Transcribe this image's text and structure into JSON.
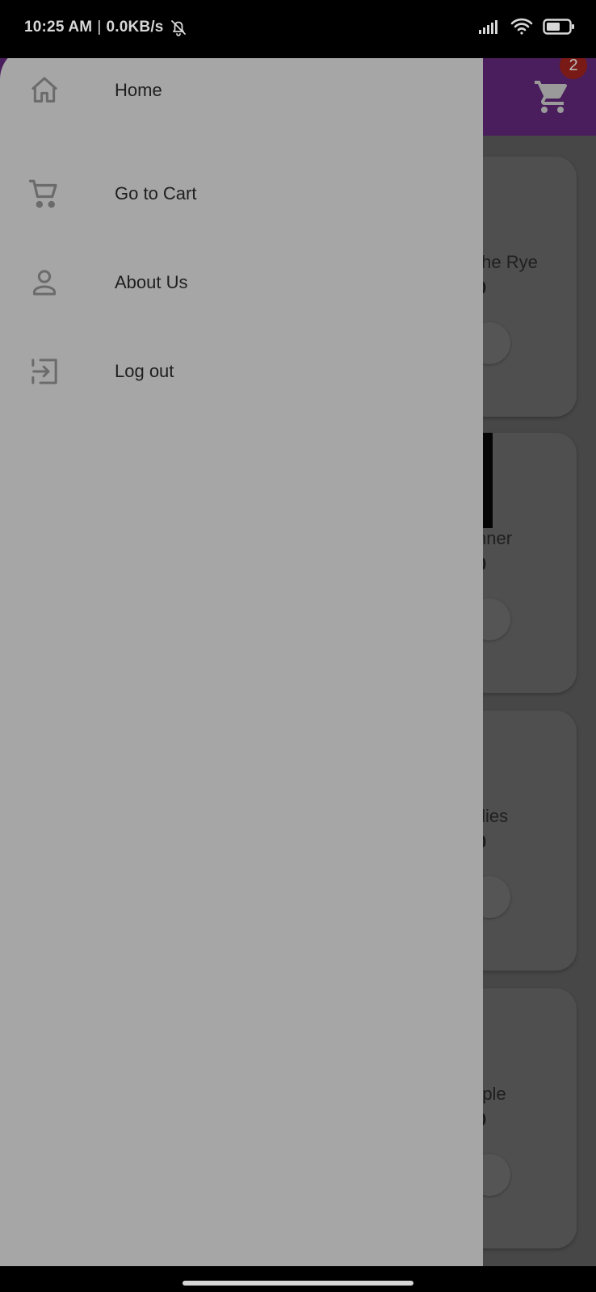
{
  "status_bar": {
    "time": "10:25 AM",
    "separator": "|",
    "network_speed": "0.0KB/s",
    "icons": [
      "bell-off-icon",
      "signal-icon",
      "wifi-icon",
      "battery-icon"
    ]
  },
  "app_bar": {
    "cart_icon": "shopping-cart-icon",
    "cart_badge_count": "2",
    "background_color": "#4a1e5c"
  },
  "products": [
    {
      "title_visible": "the Rye",
      "price_visible": "0"
    },
    {
      "title_visible": "nner",
      "price_visible": "0"
    },
    {
      "title_visible": "flies",
      "price_visible": "0"
    },
    {
      "title_visible": "rple",
      "price_visible": "0"
    }
  ],
  "drawer": {
    "background_color": "#a6a6a6",
    "items": [
      {
        "label": "Home",
        "icon": "home-icon"
      },
      {
        "label": "Go to Cart",
        "icon": "shopping-cart-icon"
      },
      {
        "label": "About Us",
        "icon": "person-icon"
      },
      {
        "label": "Log out",
        "icon": "logout-icon"
      }
    ]
  }
}
